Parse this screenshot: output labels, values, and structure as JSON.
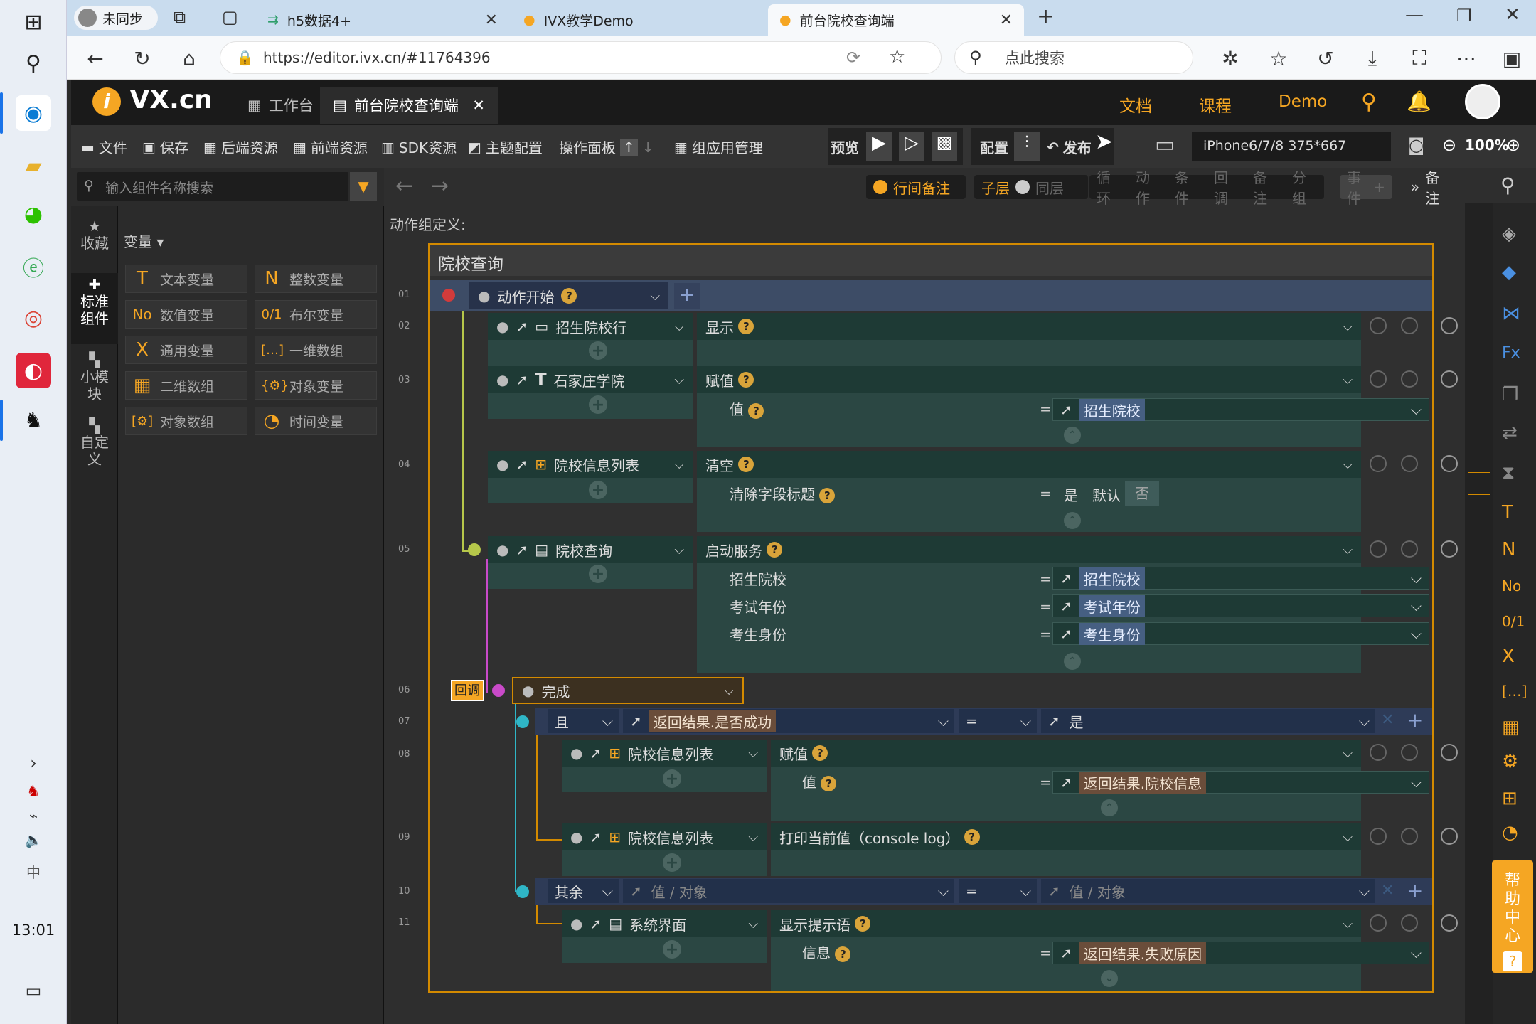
{
  "taskbar": {
    "time": "13:01"
  },
  "browser": {
    "profile": "未同步",
    "tabs": [
      {
        "label": "h5数据4+"
      },
      {
        "label": "IVX教学Demo"
      },
      {
        "label": "前台院校查询端"
      }
    ],
    "url": "https://editor.ivx.cn/#11764396",
    "search_placeholder": "点此搜索"
  },
  "app": {
    "logo": "VX.cn",
    "tabs": [
      {
        "label": "工作台"
      },
      {
        "label": "前台院校查询端"
      }
    ],
    "links": [
      "文档",
      "课程",
      "Demo"
    ]
  },
  "toolbar": {
    "items": [
      "文件",
      "保存",
      "后端资源",
      "前端资源",
      "SDK资源",
      "主题配置",
      "操作面板",
      "组应用管理"
    ],
    "preview": "预览",
    "config": "配置",
    "publish": "发布",
    "device": "iPhone6/7/8 375*667",
    "zoom": "100%"
  },
  "leftpanel": {
    "search_placeholder": "输入组件名称搜索",
    "nav": [
      "收藏",
      "标准组件",
      "小模块",
      "自定义"
    ],
    "var_header": "变量",
    "vars": [
      {
        "label": "文本变量",
        "icon": "T"
      },
      {
        "label": "整数变量",
        "icon": "N"
      },
      {
        "label": "数值变量",
        "icon": "No"
      },
      {
        "label": "布尔变量",
        "icon": "0/1"
      },
      {
        "label": "通用变量",
        "icon": "X"
      },
      {
        "label": "一维数组",
        "icon": "[…]"
      },
      {
        "label": "二维数组",
        "icon": "▦"
      },
      {
        "label": "对象变量",
        "icon": "{⚙}"
      },
      {
        "label": "对象数组",
        "icon": "[⚙]"
      },
      {
        "label": "时间变量",
        "icon": "◔"
      }
    ]
  },
  "subbar": {
    "row_note": "行间备注",
    "child": "子层",
    "same": "同层",
    "dim": [
      "循环",
      "动作",
      "条件",
      "回调",
      "备注",
      "分组"
    ],
    "event": "事件",
    "note": "备注"
  },
  "canvas": {
    "def_label": "动作组定义:",
    "title": "院校查询",
    "lines": [
      "01",
      "02",
      "03",
      "04",
      "05",
      "06",
      "07",
      "08",
      "09",
      "10",
      "11"
    ],
    "start": "动作开始",
    "rows": [
      {
        "comp": "招生院校行",
        "action": "显示"
      },
      {
        "comp": "石家庄学院",
        "action": "赋值",
        "params": [
          {
            "k": "值",
            "v": "招生院校"
          }
        ]
      },
      {
        "comp": "院校信息列表",
        "action": "清空",
        "params": [
          {
            "k": "清除字段标题",
            "v": "否"
          }
        ],
        "yes": "是",
        "default": "默认"
      },
      {
        "comp": "院校查询",
        "action": "启动服务",
        "params": [
          {
            "k": "招生院校",
            "v": "招生院校"
          },
          {
            "k": "考试年份",
            "v": "考试年份"
          },
          {
            "k": "考生身份",
            "v": "考生身份"
          }
        ]
      }
    ],
    "callback_tag": "回调",
    "callback": "完成",
    "cond1": {
      "op": "且",
      "left": "返回结果.是否成功",
      "eq": "=",
      "right": "是"
    },
    "row8": {
      "comp": "院校信息列表",
      "action": "赋值",
      "params": [
        {
          "k": "值",
          "v": "返回结果.院校信息"
        }
      ]
    },
    "row9": {
      "comp": "院校信息列表",
      "action": "打印当前值（console log）"
    },
    "cond2": {
      "op": "其余",
      "left": "值 / 对象",
      "eq": "=",
      "right": "值 / 对象"
    },
    "row11": {
      "comp": "系统界面",
      "action": "显示提示语",
      "params": [
        {
          "k": "信息",
          "v": "返回结果.失败原因"
        }
      ]
    }
  },
  "help": "帮助中心"
}
